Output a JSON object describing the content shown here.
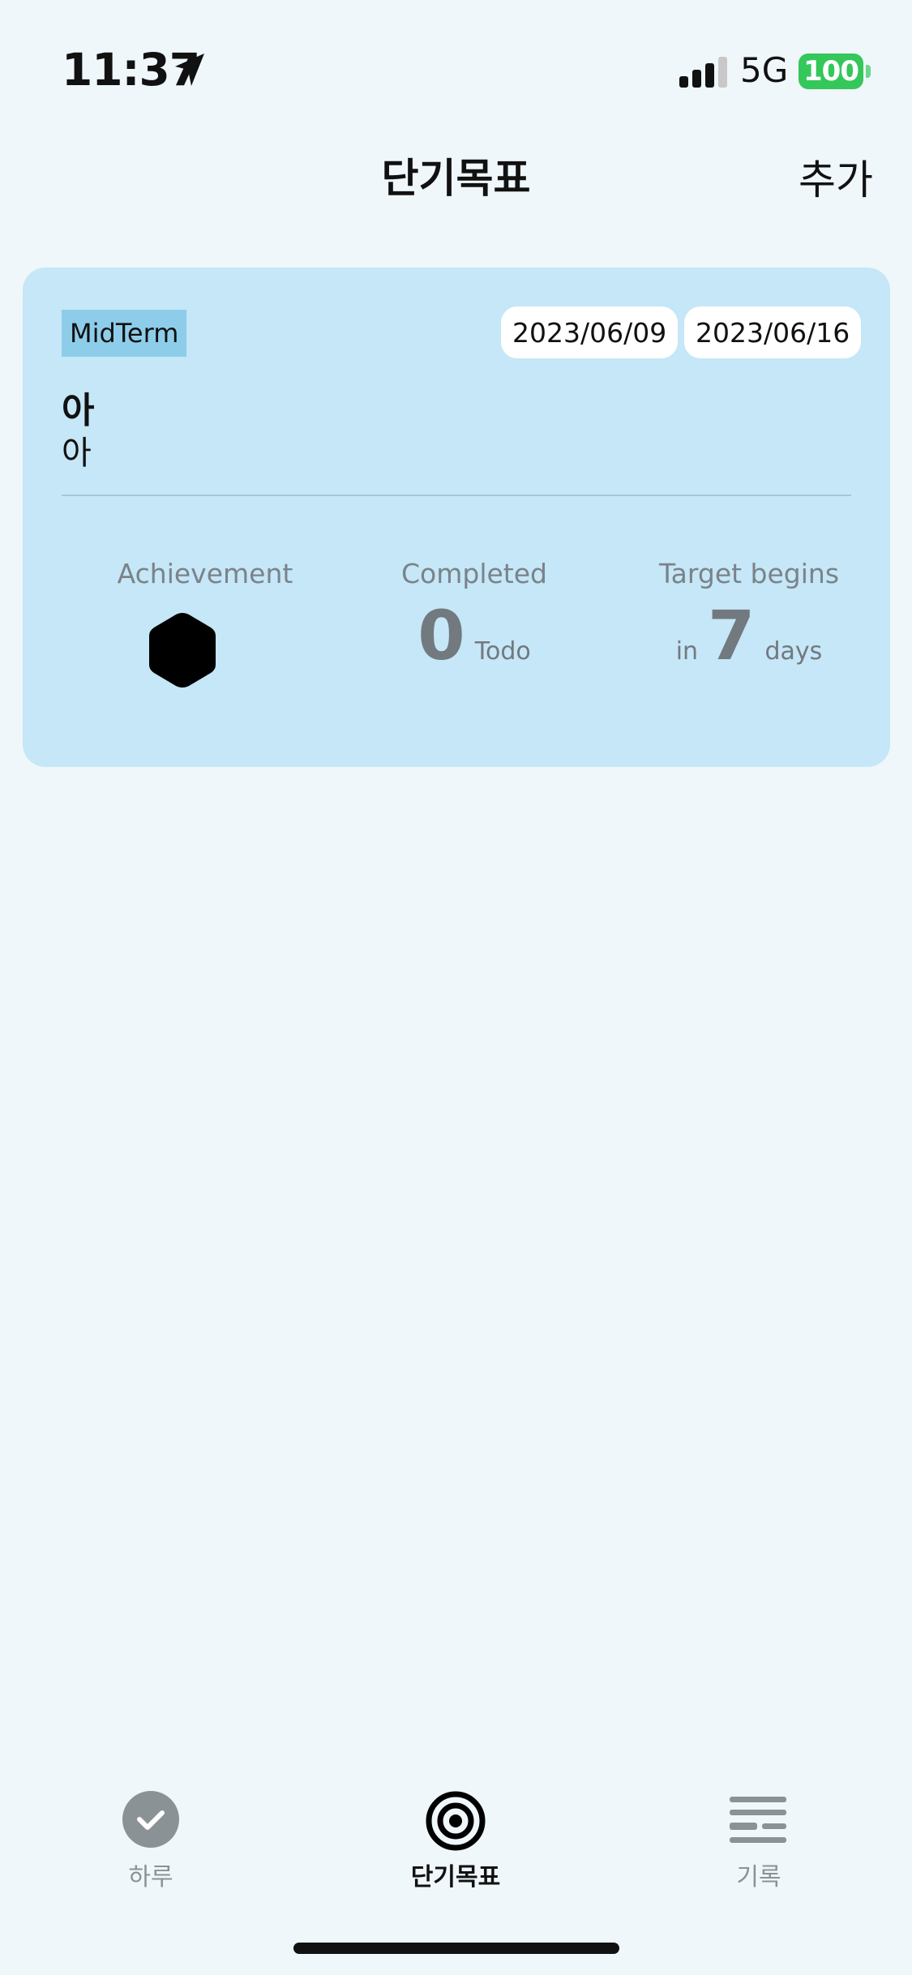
{
  "status_bar": {
    "time": "11:37",
    "network": "5G",
    "battery": "100",
    "icons": [
      "location-arrow-icon",
      "signal-icon",
      "battery-icon"
    ]
  },
  "nav": {
    "title": "단기목표",
    "add_label": "추가"
  },
  "goal_card": {
    "type_badge": "MidTerm",
    "start_date": "2023/06/09",
    "end_date": "2023/06/16",
    "title": "아",
    "description": "아",
    "stats": {
      "achievement_label": "Achievement",
      "achievement_icon": "hexagon-icon",
      "completed_label": "Completed",
      "completed_value": "0",
      "completed_unit": "Todo",
      "target_label": "Target begins",
      "target_prefix": "in",
      "target_value": "7",
      "target_unit": "days"
    }
  },
  "tab_bar": {
    "tabs": [
      {
        "label": "하루",
        "icon": "check-circle-icon",
        "active": false
      },
      {
        "label": "단기목표",
        "icon": "target-icon",
        "active": true
      },
      {
        "label": "기록",
        "icon": "list-lines-icon",
        "active": false
      }
    ]
  },
  "colors": {
    "background": "#eff7fb",
    "card": "#c5e7f7",
    "badge": "#8ecdea",
    "battery": "#34c759",
    "muted_text": "#7a8389"
  }
}
